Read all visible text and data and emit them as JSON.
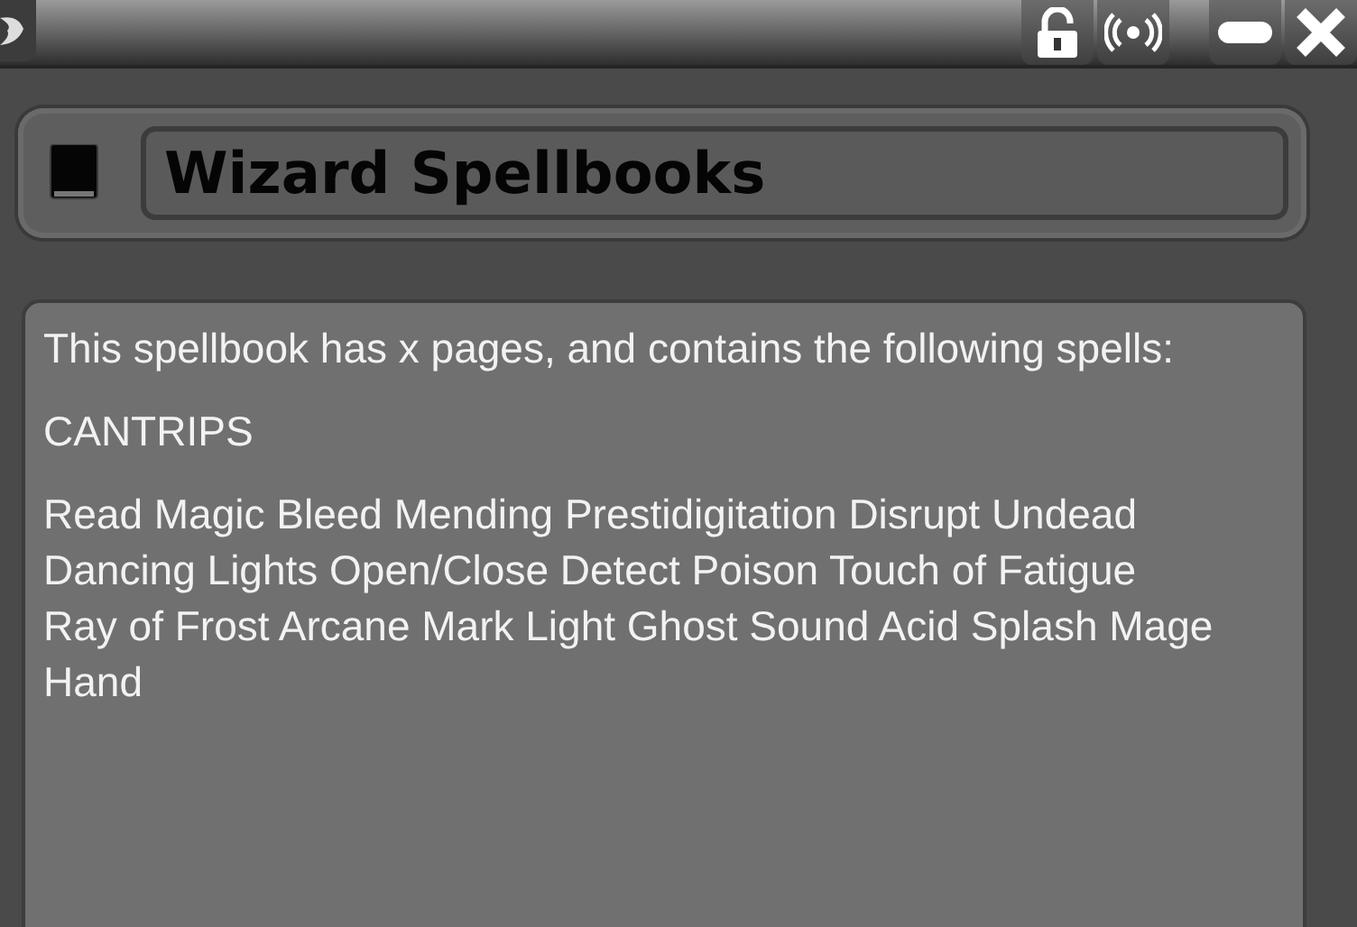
{
  "window": {
    "buttons": [
      {
        "kind": "lock",
        "locked": false
      },
      {
        "kind": "broadcast"
      },
      {
        "kind": "minimize"
      },
      {
        "kind": "close"
      }
    ]
  },
  "header": {
    "title": "Wizard Spellbooks"
  },
  "content": {
    "intro": "This spellbook has x pages, and contains the following spells:",
    "section_heading": "CANTRIPS",
    "spells": "Read Magic Bleed Mending Prestidigitation Disrupt Undead Dancing Lights Open/Close Detect Poison Touch of Fatigue Ray of Frost Arcane Mark Light Ghost Sound Acid Splash Mage Hand"
  }
}
